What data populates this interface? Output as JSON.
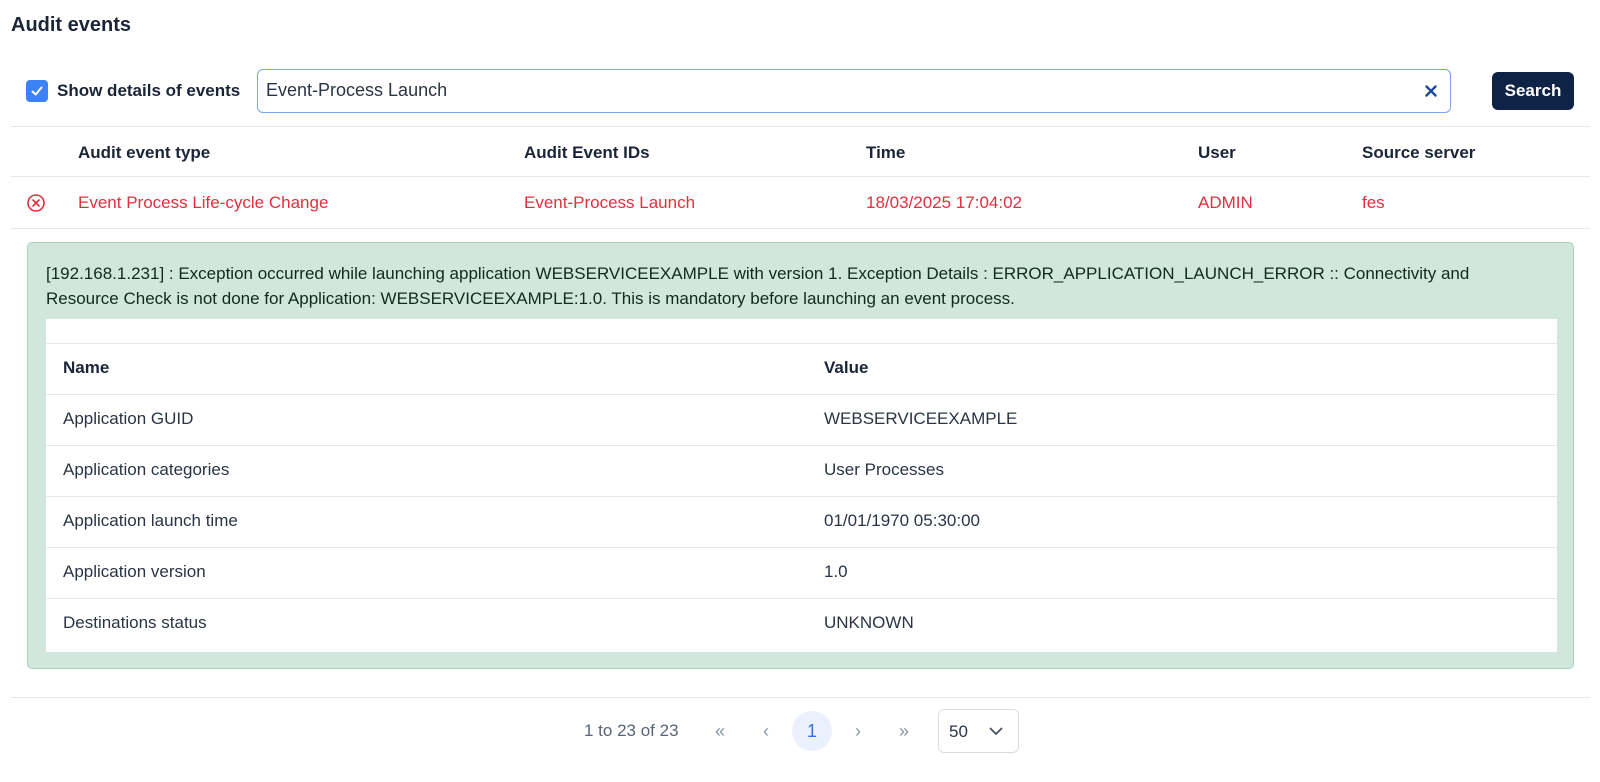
{
  "page": {
    "title": "Audit events"
  },
  "toolbar": {
    "show_details_label": "Show details of events",
    "show_details_checked": true,
    "search_value": "Event-Process Launch",
    "search_button": "Search"
  },
  "table": {
    "headers": [
      "Audit event type",
      "Audit Event IDs",
      "Time",
      "User",
      "Source server"
    ],
    "rows": [
      {
        "status_icon": "error-circle-x-icon",
        "event_type": "Event Process Life-cycle Change",
        "event_ids": "Event-Process Launch",
        "time": "18/03/2025 17:04:02",
        "user": "ADMIN",
        "source_server": "fes"
      }
    ]
  },
  "details": {
    "message": "[192.168.1.231] : Exception occurred while launching application WEBSERVICEEXAMPLE with version 1. Exception Details : ERROR_APPLICATION_LAUNCH_ERROR :: Connectivity and Resource Check is not done for Application: WEBSERVICEEXAMPLE:1.0. This is mandatory before launching an event process.",
    "headers": [
      "Name",
      "Value"
    ],
    "rows": [
      {
        "name": "Application GUID",
        "value": "WEBSERVICEEXAMPLE"
      },
      {
        "name": "Application categories",
        "value": "User Processes"
      },
      {
        "name": "Application launch time",
        "value": "01/01/1970 05:30:00"
      },
      {
        "name": "Application version",
        "value": "1.0"
      },
      {
        "name": "Destinations status",
        "value": "UNKNOWN"
      }
    ]
  },
  "pagination": {
    "range_text": "1 to 23 of 23",
    "current_page": "1",
    "first_icon": "«",
    "prev_icon": "‹",
    "next_icon": "›",
    "last_icon": "»",
    "page_size": "50"
  },
  "colors": {
    "error_red": "#e0303e",
    "primary_button": "#0f2346",
    "details_bg": "#d1e7dd",
    "checkbox_blue": "#3b82f6"
  }
}
